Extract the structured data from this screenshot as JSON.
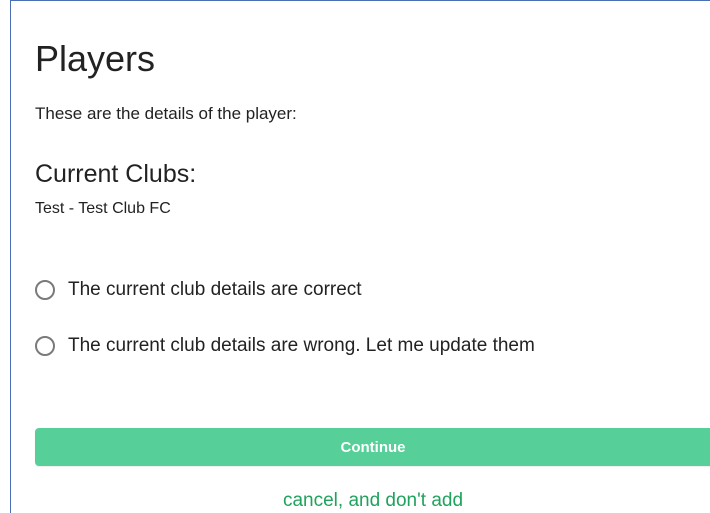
{
  "page": {
    "title": "Players",
    "intro": "These are the details of the player:"
  },
  "clubs": {
    "heading": "Current Clubs:",
    "value": "Test - Test Club FC"
  },
  "options": [
    {
      "label": "The current club details are correct",
      "selected": false
    },
    {
      "label": "The current club details are wrong. Let me update them",
      "selected": false
    }
  ],
  "actions": {
    "continue_label": "Continue",
    "cancel_label": "cancel, and don't add"
  },
  "colors": {
    "button_bg": "#57cf98",
    "link": "#1fa35c",
    "frame_border": "#4a6fb5"
  }
}
